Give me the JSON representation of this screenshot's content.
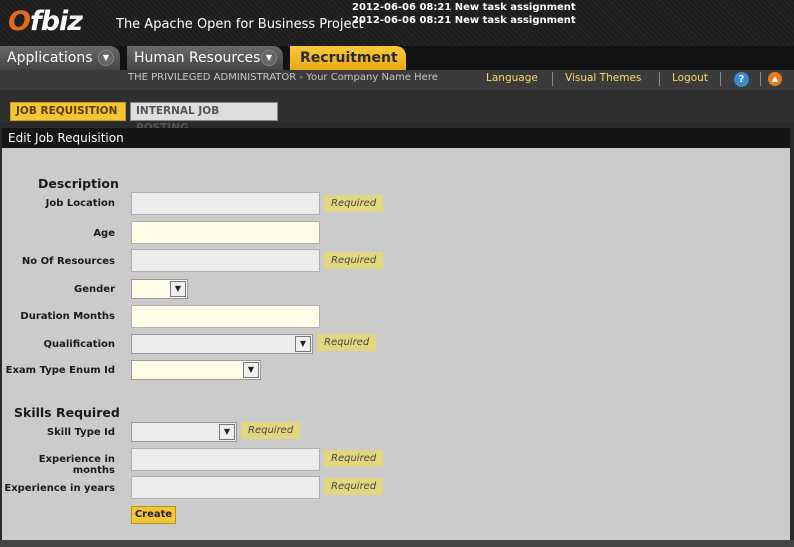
{
  "header": {
    "logo_prefix": "O",
    "logo_rest": "fbiz",
    "tagline": "The Apache Open for Business Project",
    "notifications": [
      "2012-06-06 08:21 New task assignment",
      "2012-06-06 08:21 New task assignment"
    ]
  },
  "app_tabs": [
    {
      "label": "Applications"
    },
    {
      "label": "Human Resources"
    },
    {
      "label": "Recruitment"
    }
  ],
  "user_bar": {
    "user": "THE PRIVILEGED ADMINISTRATOR - Your Company Name Here",
    "language": "Language",
    "visual_themes": "Visual Themes",
    "logout": "Logout",
    "help_icon": "?",
    "up_icon": "▲"
  },
  "sub_tabs": [
    {
      "label": "JOB REQUISITION"
    },
    {
      "label": "INTERNAL JOB POSTING"
    }
  ],
  "panel": {
    "title": "Edit Job Requisition",
    "sections": {
      "description": "Description",
      "skills": "Skills Required"
    },
    "fields": {
      "job_location": {
        "label": "Job Location",
        "value": "",
        "required": "Required"
      },
      "age": {
        "label": "Age",
        "value": ""
      },
      "no_of_resources": {
        "label": "No Of Resources",
        "value": "",
        "required": "Required"
      },
      "gender": {
        "label": "Gender",
        "value": ""
      },
      "duration_months": {
        "label": "Duration Months",
        "value": ""
      },
      "qualification": {
        "label": "Qualification",
        "value": "",
        "required": "Required"
      },
      "exam_type": {
        "label": "Exam Type Enum Id",
        "value": ""
      },
      "skill_type": {
        "label": "Skill Type Id",
        "value": "",
        "required": "Required"
      },
      "exp_months": {
        "label": "Experience in months",
        "value": "",
        "required": "Required"
      },
      "exp_years": {
        "label": "Experience in years",
        "value": "",
        "required": "Required"
      }
    },
    "create_label": "Create"
  },
  "colors": {
    "accent": "#f3c637",
    "required_badge": "#e3d680",
    "panel_bg": "#cbcbcb"
  }
}
